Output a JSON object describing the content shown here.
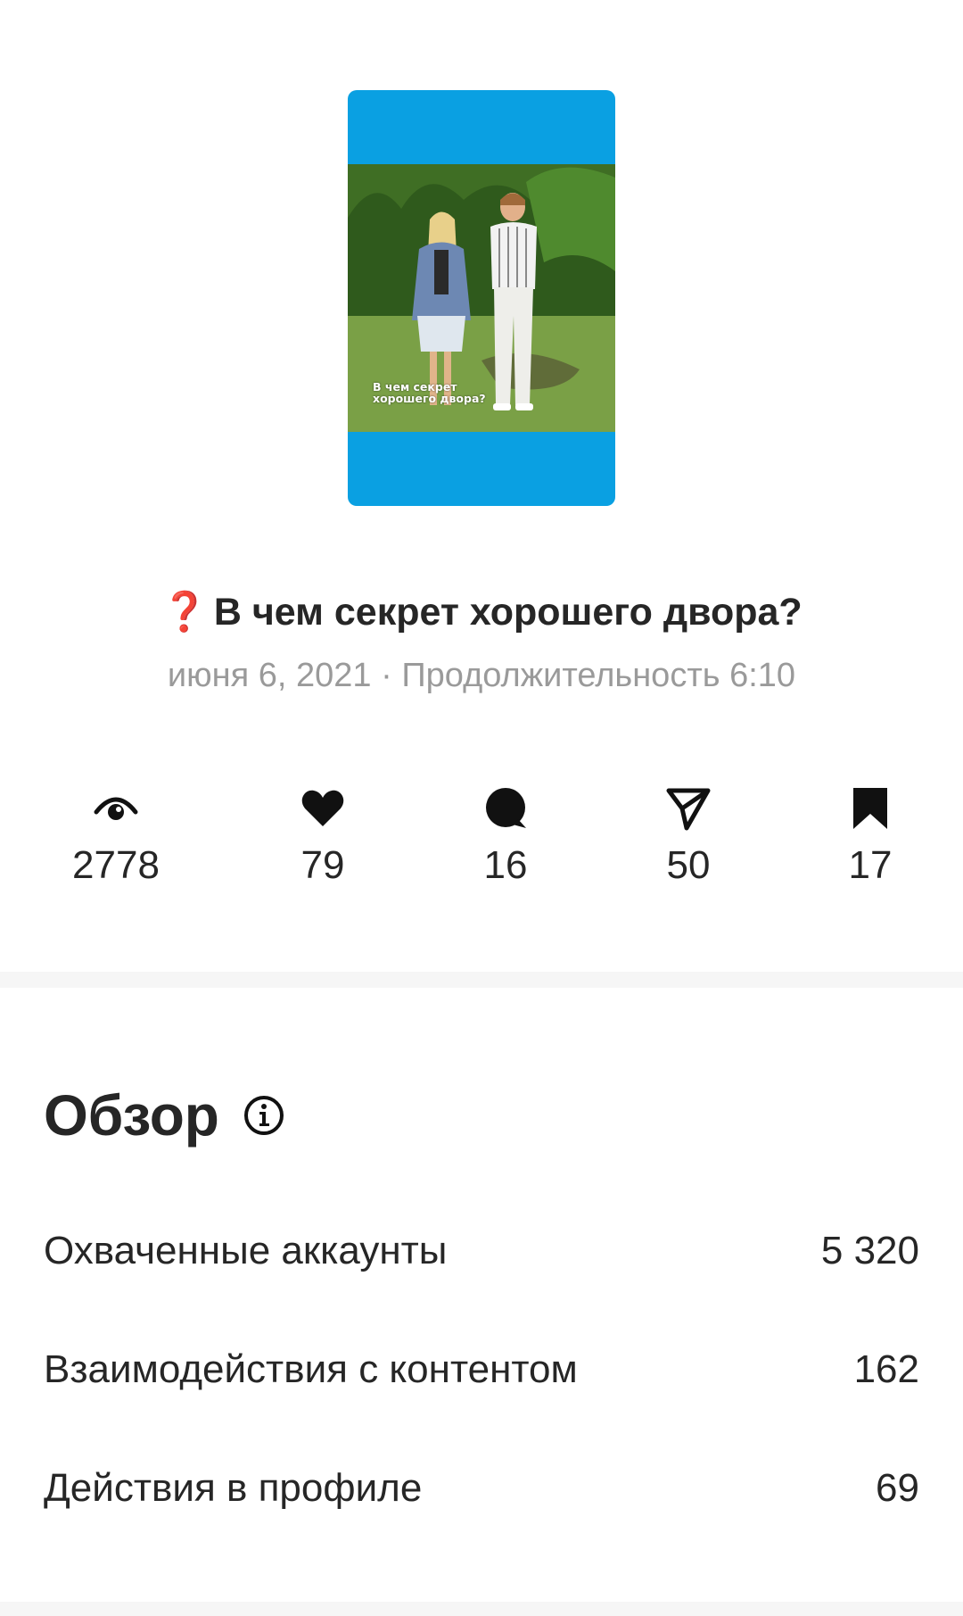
{
  "post": {
    "thumbnail_caption": "В чем секрет хорошего двора?",
    "title_icon": "red-question-mark-icon",
    "title": "В чем секрет хорошего двора?",
    "date": "июня 6, 2021",
    "separator": "·",
    "duration_label": "Продолжительность",
    "duration": "6:10"
  },
  "stats": [
    {
      "icon": "eye-icon",
      "value": "2778"
    },
    {
      "icon": "heart-icon",
      "value": "79"
    },
    {
      "icon": "comment-icon",
      "value": "16"
    },
    {
      "icon": "share-icon",
      "value": "50"
    },
    {
      "icon": "bookmark-icon",
      "value": "17"
    }
  ],
  "overview": {
    "title": "Обзор",
    "info_icon": "info-icon",
    "rows": [
      {
        "label": "Охваченные аккаунты",
        "value": "5 320"
      },
      {
        "label": "Взаимодействия с контентом",
        "value": "162"
      },
      {
        "label": "Действия в профиле",
        "value": "69"
      }
    ]
  },
  "colors": {
    "thumbnail_background": "#0aa0e2",
    "text_primary": "#262626",
    "text_secondary": "#9a9a9a",
    "question_mark": "#d6232b",
    "divider": "#f6f6f6"
  }
}
